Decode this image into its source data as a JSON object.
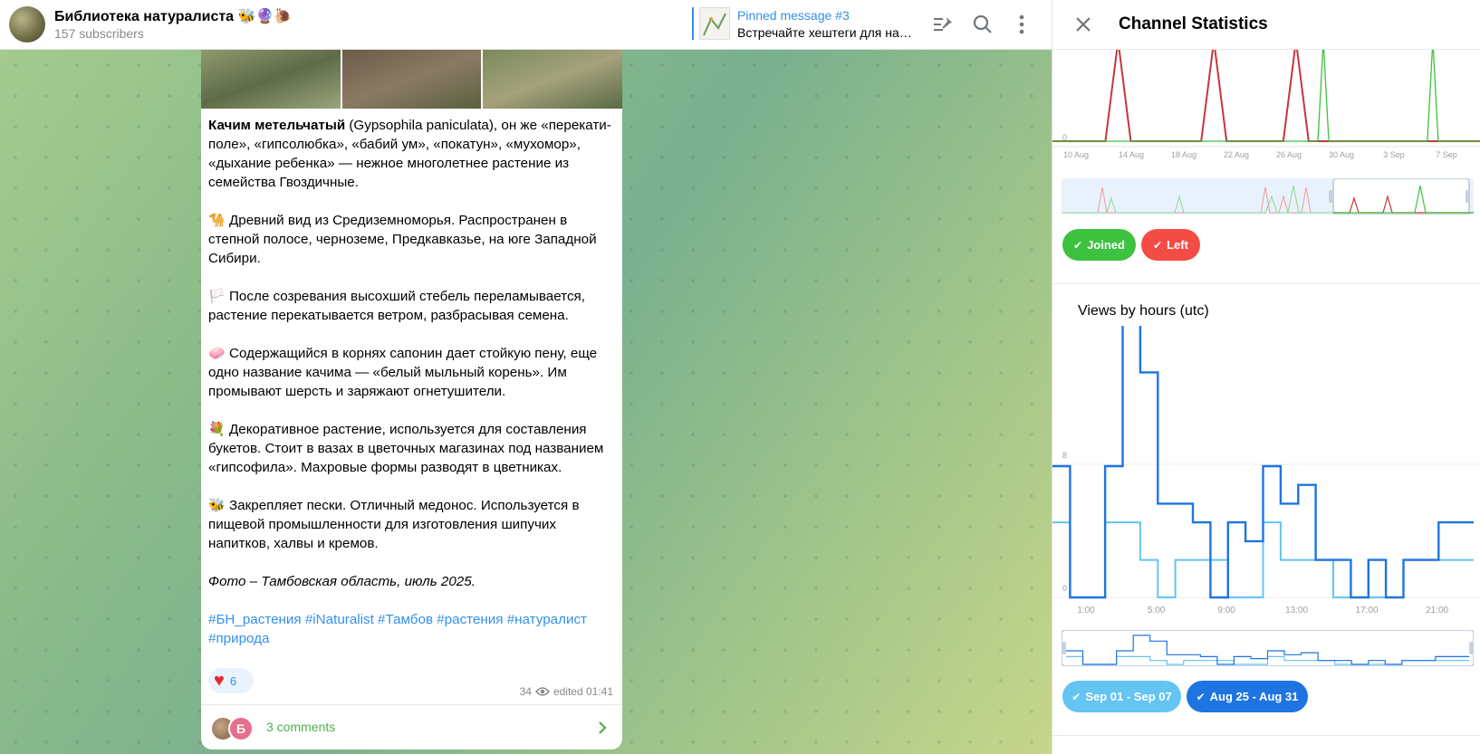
{
  "header": {
    "channel_title": "Библиотека натуралиста 🐝🔮🐌",
    "subscribers": "157 subscribers",
    "pinned_title": "Pinned message #3",
    "pinned_text": "Встречайте хештеги для нав…"
  },
  "message": {
    "bold_name": "Качим метельчатый",
    "intro": " (Gypsophila paniculata), он же «перекати-поле», «гипсолюбка», «бабий ум», «покатун», «мухомор», «дыхание ребенка» — нежное многолетнее растение из семейства Гвоздичные.",
    "p1_emoji": "🐪",
    "p1": "Древний вид из Средиземноморья. Распространен в степной полосе, черноземе, Предкавказье, на юге Западной Сибири.",
    "p2_emoji": "🏳️",
    "p2": "После созревания высохший стебель переламывается, растение перекатывается ветром, разбрасывая семена.",
    "p3_emoji": "🧼",
    "p3": "Содержащийся в корнях сапонин дает стойкую пену, еще одно название качима — «белый мыльный корень». Им промывают шерсть и заряжают огнетушители.",
    "p4_emoji": "💐",
    "p4": "Декоративное растение, используется для составления букетов. Стоит в вазах в цветочных магазинах под названием «гипсофила». Махровые формы разводят в цветниках.",
    "p5_emoji": "🐝",
    "p5": "Закрепляет пески. Отличный медонос. Используется в пищевой промышленности для изготовления шипучих напитков, халвы и кремов.",
    "photo_caption": "Фото – Тамбовская область, июль 2025.",
    "tags": "#БН_растения #iNaturalist #Тамбов #растения #натуралист #природа",
    "reaction_count": "6",
    "views": "34",
    "edited": "edited 01:41",
    "comments_label": "3 comments",
    "comment_avatar_letter": "Б"
  },
  "stats_panel": {
    "title": "Channel Statistics",
    "followers_chart": {
      "zero_label": "0",
      "x_labels": [
        "10 Aug",
        "14 Aug",
        "18 Aug",
        "22 Aug",
        "26 Aug",
        "30 Aug",
        "3 Sep",
        "7 Sep"
      ],
      "joined_label": "Joined",
      "left_label": "Left",
      "joined_color": "#3cc23f",
      "left_color": "#f34c44"
    },
    "views_chart": {
      "title": "Views by hours (utc)",
      "y_labels": [
        "8",
        "0"
      ],
      "x_labels": [
        "1:00",
        "5:00",
        "9:00",
        "13:00",
        "17:00",
        "21:00"
      ],
      "series1_label": "Sep 01 - Sep 07",
      "series2_label": "Aug 25 - Aug 31",
      "series1_color": "#64c4f2",
      "series2_color": "#1e74e0"
    }
  },
  "chart_data": [
    {
      "type": "line",
      "x": [
        "10 Aug",
        "14 Aug",
        "18 Aug",
        "22 Aug",
        "26 Aug",
        "30 Aug",
        "3 Sep",
        "7 Sep"
      ],
      "series": [
        {
          "name": "Joined",
          "peaks_at": [
            "29 Aug",
            "6 Sep"
          ]
        },
        {
          "name": "Left",
          "peaks_at": [
            "14 Aug",
            "21 Aug",
            "27 Aug"
          ]
        }
      ]
    },
    {
      "type": "line",
      "title": "Views by hours (utc)",
      "x": [
        "0:00",
        "1:00",
        "2:00",
        "3:00",
        "4:00",
        "5:00",
        "6:00",
        "7:00",
        "8:00",
        "9:00",
        "10:00",
        "11:00",
        "12:00",
        "13:00",
        "14:00",
        "15:00",
        "16:00",
        "17:00",
        "18:00",
        "19:00",
        "20:00",
        "21:00",
        "22:00",
        "23:00"
      ],
      "ylim": [
        0,
        14
      ],
      "series": [
        {
          "name": "Sep 01 - Sep 07",
          "values": [
            4,
            0,
            0,
            4,
            4,
            2,
            0,
            2,
            2,
            2,
            0,
            0,
            4,
            2,
            2,
            2,
            0,
            0,
            0,
            0,
            2,
            2,
            2,
            2
          ]
        },
        {
          "name": "Aug 25 - Aug 31",
          "values": [
            7,
            0,
            0,
            7,
            15,
            12,
            5,
            5,
            4,
            0,
            4,
            3,
            7,
            5,
            6,
            2,
            2,
            0,
            2,
            0,
            2,
            2,
            4,
            4
          ]
        }
      ]
    }
  ]
}
